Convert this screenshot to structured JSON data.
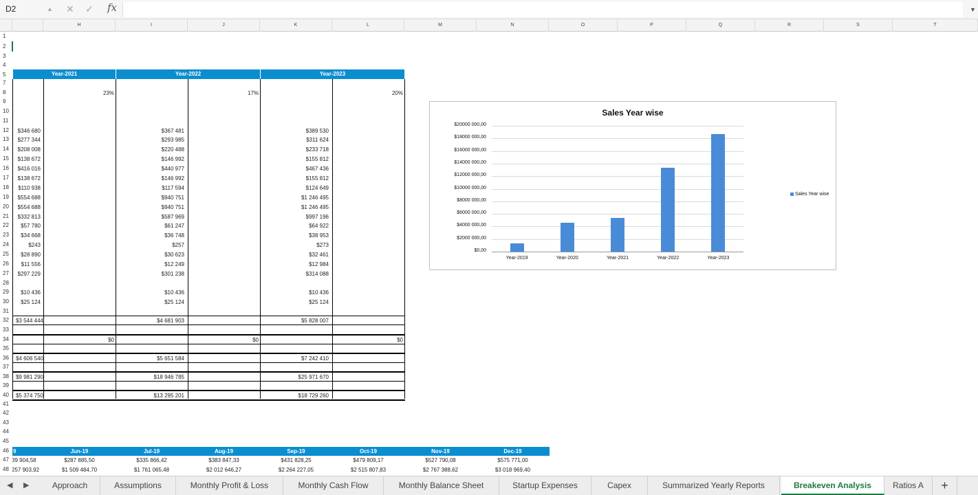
{
  "formula_bar": {
    "name_box": "D2",
    "fx": "fx",
    "formula": ""
  },
  "columns": [
    "H",
    "I",
    "J",
    "K",
    "L",
    "M",
    "N",
    "O",
    "P",
    "Q",
    "R",
    "S",
    "T"
  ],
  "rows": [
    "1",
    "2",
    "3",
    "4",
    "5",
    "7",
    "8",
    "9",
    "10",
    "11",
    "12",
    "13",
    "14",
    "15",
    "16",
    "17",
    "18",
    "19",
    "20",
    "21",
    "22",
    "23",
    "24",
    "25",
    "26",
    "27",
    "28",
    "29",
    "30",
    "31",
    "32",
    "33",
    "34",
    "35",
    "36",
    "37",
    "38",
    "39",
    "40",
    "41",
    "42",
    "43",
    "44",
    "45",
    "46",
    "47",
    "48"
  ],
  "year_headers": [
    "Year-2021",
    "Year-2022",
    "Year-2023"
  ],
  "growth": [
    "23%",
    "17%",
    "20%"
  ],
  "year_table": {
    "col_2021": [
      "$346 680",
      "$277 344",
      "$208 008",
      "$138 672",
      "$416 016",
      "$138 672",
      "$110 938",
      "$554 688",
      "$554 688",
      "$332 813",
      "$57 780",
      "$34 668",
      "$243",
      "$28 890",
      "$11 556",
      "$297 229",
      "",
      "$10 436",
      "$25 124"
    ],
    "col_2022": [
      "$367 481",
      "$293 985",
      "$220 488",
      "$146 992",
      "$440 977",
      "$146 992",
      "$117 594",
      "$940 751",
      "$940 751",
      "$587 969",
      "$61 247",
      "$36 748",
      "$257",
      "$30 623",
      "$12 249",
      "$301 238",
      "",
      "$10 436",
      "$25 124"
    ],
    "col_2023": [
      "$389 530",
      "$311 624",
      "$233 718",
      "$155 812",
      "$467 436",
      "$155 812",
      "$124 649",
      "$1 246 495",
      "$1 246 495",
      "$997 196",
      "$64 922",
      "$38 953",
      "$273",
      "$32 461",
      "$12 984",
      "$314 088",
      "",
      "$10 436",
      "$25 124"
    ]
  },
  "totals": {
    "row32": [
      "$3 544 444",
      "$4 681 903",
      "$5 828 007"
    ],
    "row34": [
      "$0",
      "$0",
      "$0"
    ],
    "row36": [
      "$4 606 540",
      "$5 651 584",
      "$7 242 410"
    ],
    "row38": [
      "$9 981 290",
      "$18 946 785",
      "$25 971 670"
    ],
    "row40": [
      "$5 374 750",
      "$13 295 201",
      "$18 729 260"
    ]
  },
  "monthly": {
    "months": [
      "9",
      "Jun-19",
      "Jul-19",
      "Aug-19",
      "Sep-19",
      "Oct-19",
      "Nov-19",
      "Dec-19"
    ],
    "row47": [
      "39 904,58",
      "$287 885,50",
      "$335 866,42",
      "$383 847,33",
      "$431 828,25",
      "$479 809,17",
      "$527 790,08",
      "$575 771,00"
    ],
    "row48": [
      "257 903,92",
      "$1 509 484,70",
      "$1 761 065,48",
      "$2 012 646,27",
      "$2 264 227,05",
      "$2 515 807,83",
      "$2 767 388,62",
      "$3 018 969,40"
    ]
  },
  "chart_data": {
    "type": "bar",
    "title": "Sales Year wise",
    "categories": [
      "Year-2019",
      "Year-2020",
      "Year-2021",
      "Year-2022",
      "Year-2023"
    ],
    "series": [
      {
        "name": "Sales Year wise",
        "values": [
          1300000,
          4600000,
          5400000,
          13300000,
          18700000
        ]
      }
    ],
    "y_ticks": [
      "$20000 000,00",
      "$18000 000,00",
      "$16000 000,00",
      "$14000 000,00",
      "$12000 000,00",
      "$10000 000,00",
      "$8000 000,00",
      "$6000 000,00",
      "$4000 000,00",
      "$2000 000,00",
      "$0,00"
    ],
    "ylim": [
      0,
      20000000
    ],
    "grid": true,
    "legend_position": "right",
    "color": "#4a8bd8"
  },
  "tabs": [
    "Approach",
    "Assumptions",
    "Monthly Profit & Loss",
    "Monthly Cash Flow",
    "Monthly Balance Sheet",
    "Startup Expenses",
    "Capex",
    "Summarized Yearly Reports",
    "Breakeven Analysis",
    "Ratios A"
  ],
  "active_tab": "Breakeven Analysis",
  "add_sheet": "+"
}
